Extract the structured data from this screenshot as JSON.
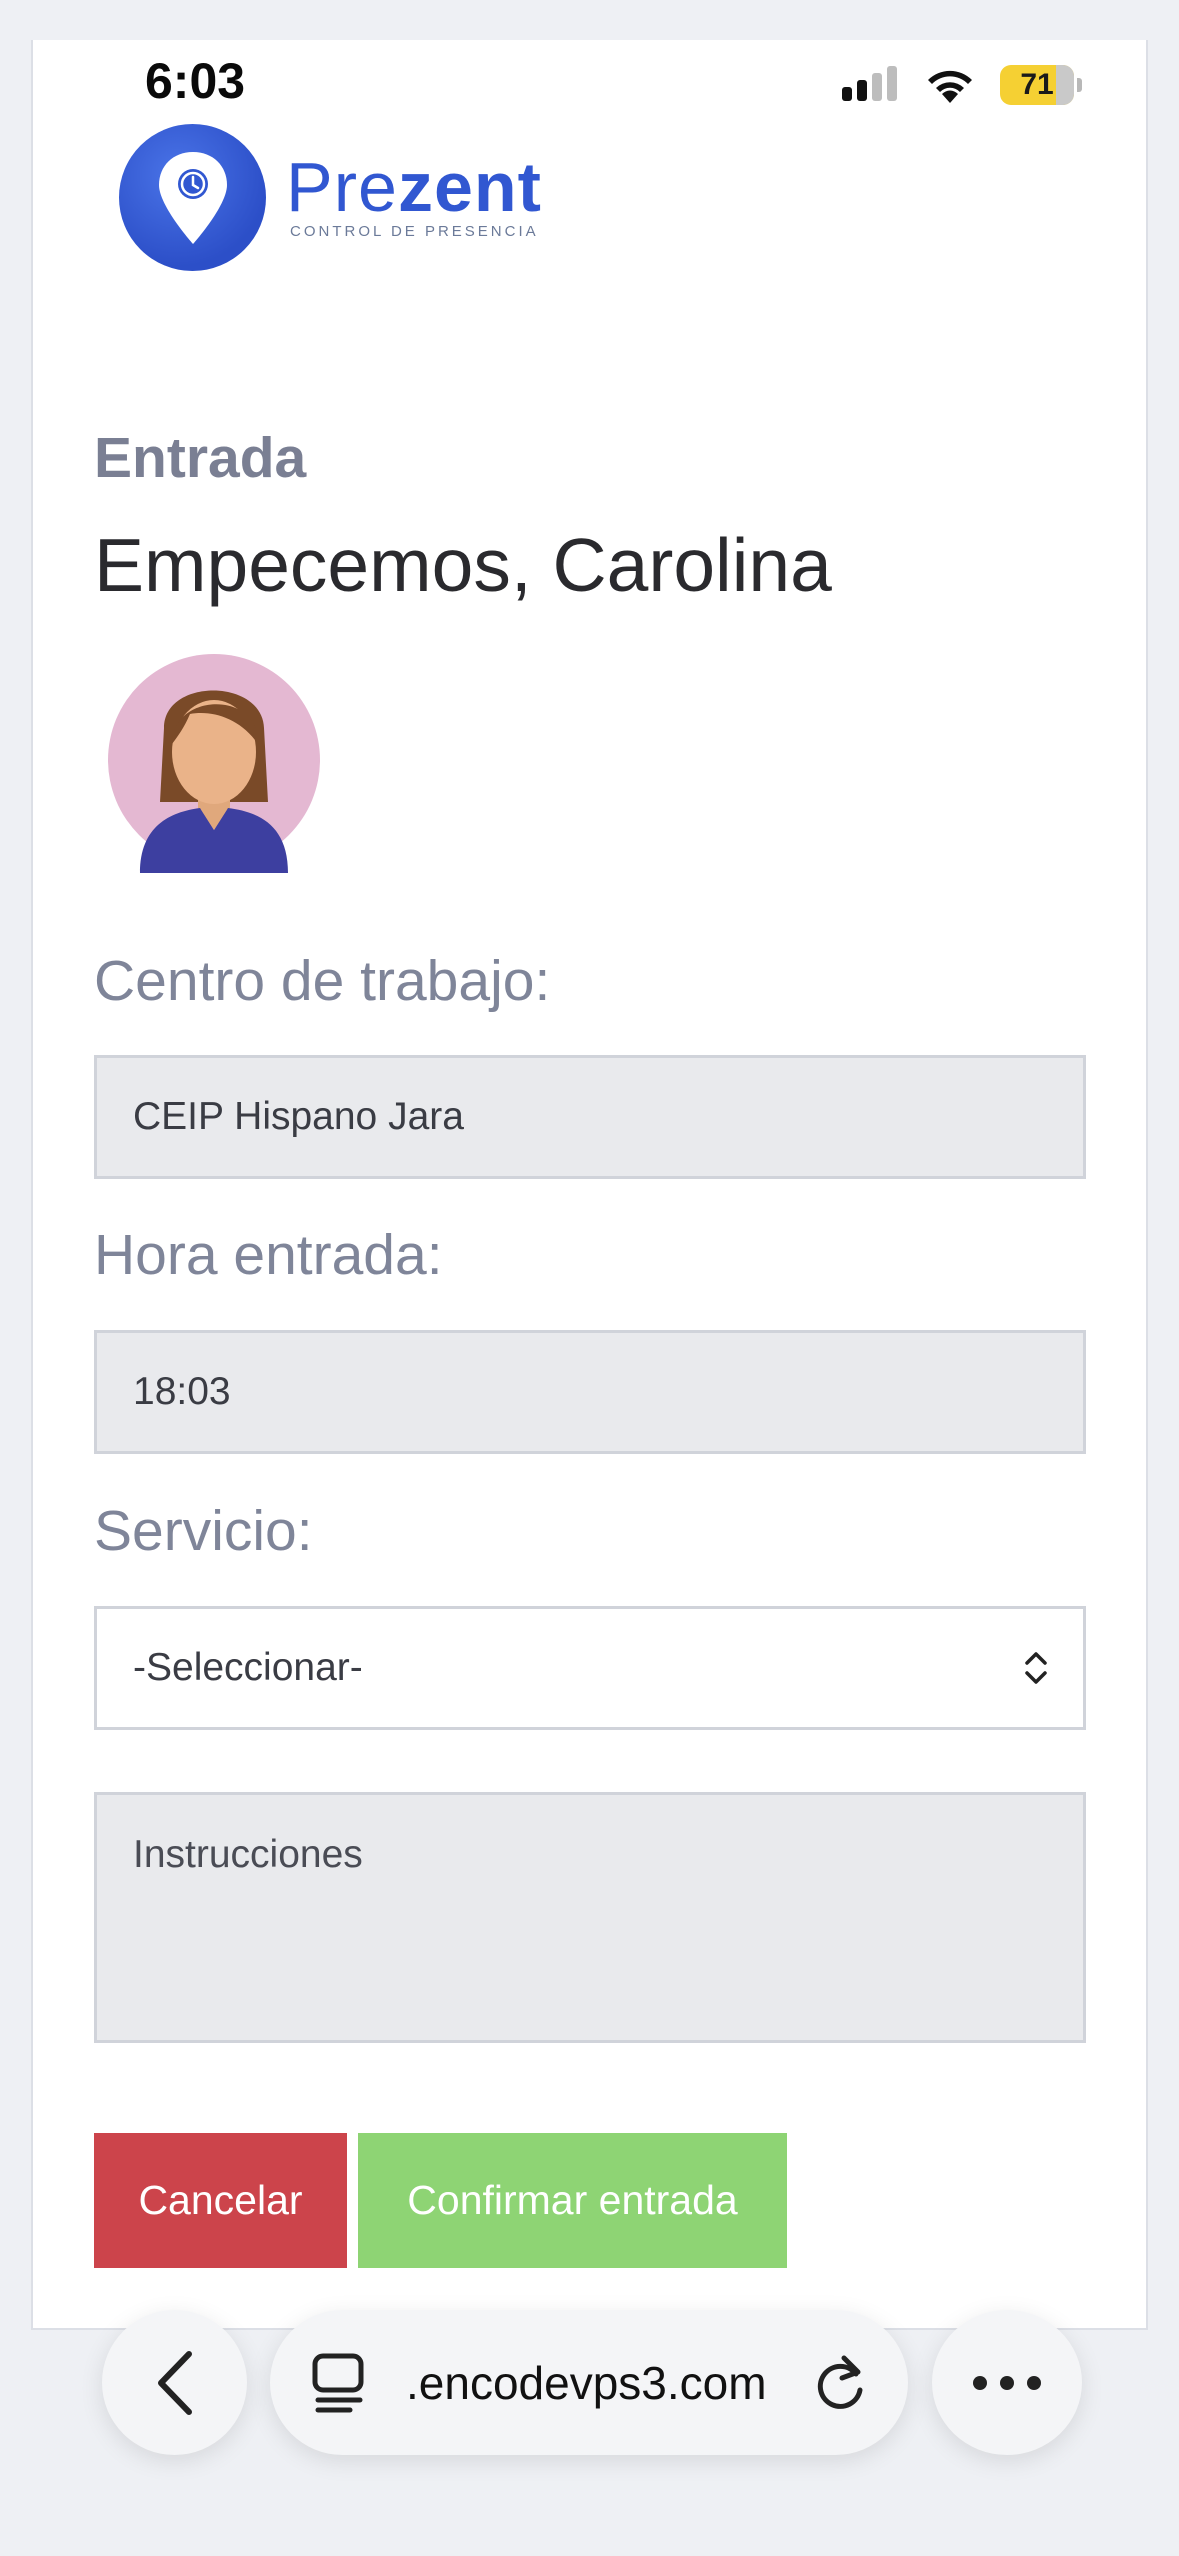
{
  "status_bar": {
    "time": "6:03",
    "battery": "71"
  },
  "brand": {
    "name_part1": "Pre",
    "name_part2": "zent",
    "tagline": "CONTROL DE PRESENCIA"
  },
  "page": {
    "section_title": "Entrada",
    "greeting": "Empecemos, Carolina"
  },
  "form": {
    "centro_label": "Centro de trabajo:",
    "centro_value": "CEIP Hispano Jara",
    "hora_label": "Hora entrada:",
    "hora_value": "18:03",
    "servicio_label": "Servicio:",
    "servicio_selected": "-Seleccionar-",
    "instrucciones_placeholder": "Instrucciones"
  },
  "buttons": {
    "cancel": "Cancelar",
    "confirm": "Confirmar entrada"
  },
  "browser": {
    "url": ".encodevps3.com"
  },
  "colors": {
    "brand": "#3157d1",
    "cancel": "#cc444b",
    "confirm": "#8ed474"
  },
  "icons": [
    "signal-icon",
    "wifi-icon",
    "battery-icon",
    "location-pin-icon",
    "clock-icon",
    "back-icon",
    "tabs-icon",
    "reload-icon",
    "more-icon",
    "chevron-updown-icon"
  ]
}
